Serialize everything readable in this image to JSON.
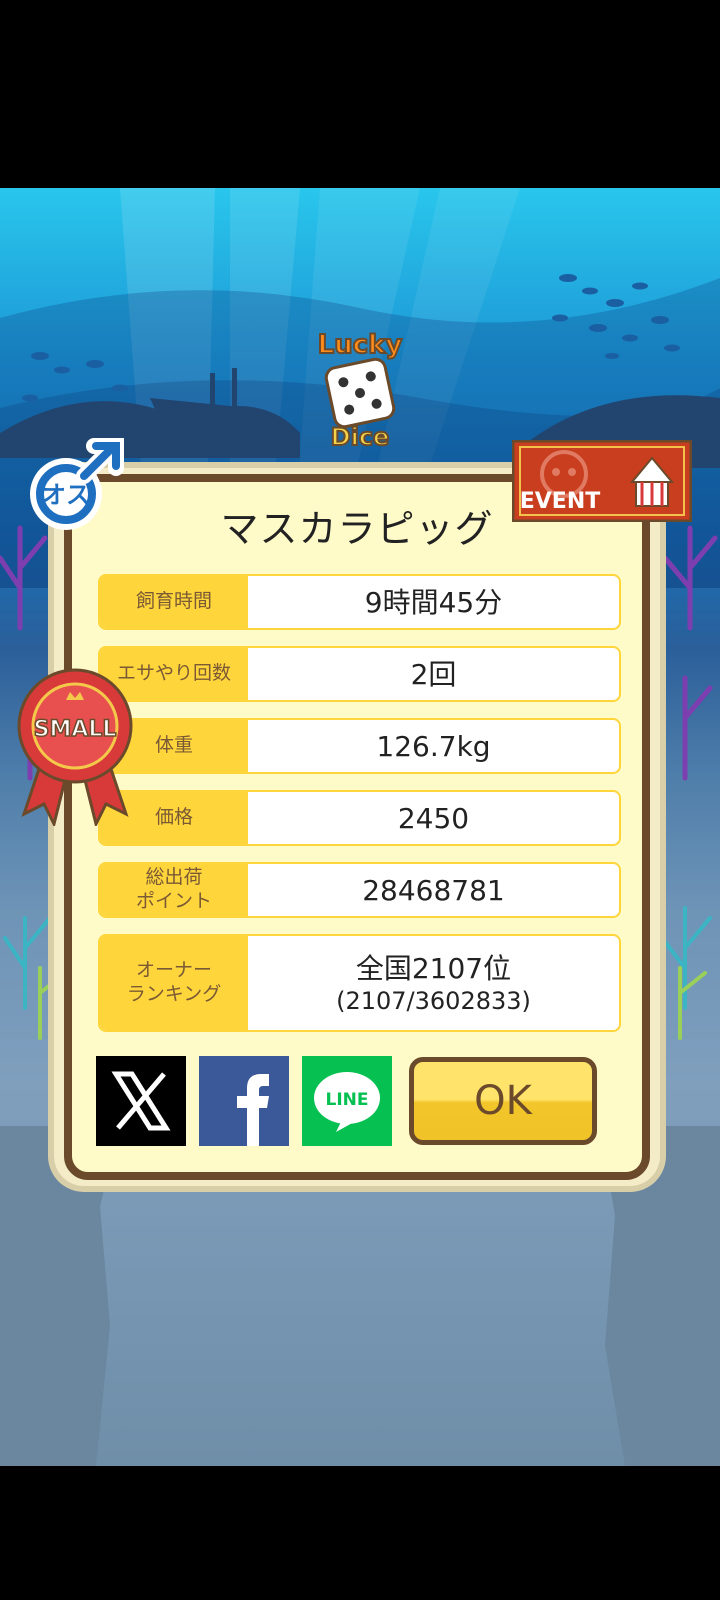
{
  "logo": {
    "line1": "Lucky",
    "line2": "Dice"
  },
  "badges": {
    "gender": "オス",
    "size": "SMALL",
    "event": "EVENT"
  },
  "animal_name": "マスカラピッグ",
  "stats": [
    {
      "label": "飼育時間",
      "value": "9時間45分"
    },
    {
      "label": "エサやり回数",
      "value": "2回"
    },
    {
      "label": "体重",
      "value": "126.7kg"
    },
    {
      "label": "価格",
      "value": "2450"
    },
    {
      "label_line1": "総出荷",
      "label_line2": "ポイント",
      "value": "28468781"
    },
    {
      "label_line1": "オーナー",
      "label_line2": "ランキング",
      "value": "全国2107位",
      "value_sub": "(2107/3602833)"
    }
  ],
  "share": {
    "line_label": "LINE"
  },
  "ok_label": "OK",
  "colors": {
    "label_bg": "#ffd53c",
    "card_border": "#6b4a2b",
    "card_bg": "#fffbc9",
    "x_bg": "#000000",
    "facebook_bg": "#3b5998",
    "line_bg": "#06c152"
  }
}
